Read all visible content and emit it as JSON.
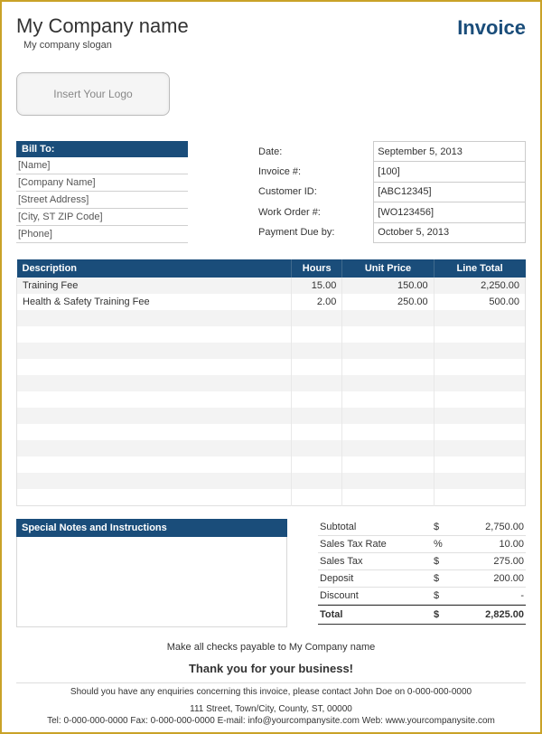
{
  "header": {
    "company_name": "My Company name",
    "company_slogan": "My company slogan",
    "invoice_label": "Invoice",
    "logo_placeholder": "Insert Your Logo"
  },
  "bill_to": {
    "header": "Bill To:",
    "lines": [
      "[Name]",
      "[Company Name]",
      "[Street Address]",
      "[City, ST  ZIP Code]",
      "[Phone]"
    ]
  },
  "meta": [
    {
      "label": "Date:",
      "value": "September 5, 2013"
    },
    {
      "label": "Invoice #:",
      "value": "[100]"
    },
    {
      "label": "Customer ID:",
      "value": "[ABC12345]"
    },
    {
      "label": "Work Order #:",
      "value": "[WO123456]"
    },
    {
      "label": "Payment Due by:",
      "value": "October 5, 2013"
    }
  ],
  "items": {
    "headers": {
      "description": "Description",
      "hours": "Hours",
      "unit_price": "Unit Price",
      "line_total": "Line Total"
    },
    "rows": [
      {
        "description": "Training Fee",
        "hours": "15.00",
        "unit_price": "150.00",
        "line_total": "2,250.00"
      },
      {
        "description": "Health & Safety Training Fee",
        "hours": "2.00",
        "unit_price": "250.00",
        "line_total": "500.00"
      },
      {
        "description": "",
        "hours": "",
        "unit_price": "",
        "line_total": ""
      },
      {
        "description": "",
        "hours": "",
        "unit_price": "",
        "line_total": ""
      },
      {
        "description": "",
        "hours": "",
        "unit_price": "",
        "line_total": ""
      },
      {
        "description": "",
        "hours": "",
        "unit_price": "",
        "line_total": ""
      },
      {
        "description": "",
        "hours": "",
        "unit_price": "",
        "line_total": ""
      },
      {
        "description": "",
        "hours": "",
        "unit_price": "",
        "line_total": ""
      },
      {
        "description": "",
        "hours": "",
        "unit_price": "",
        "line_total": ""
      },
      {
        "description": "",
        "hours": "",
        "unit_price": "",
        "line_total": ""
      },
      {
        "description": "",
        "hours": "",
        "unit_price": "",
        "line_total": ""
      },
      {
        "description": "",
        "hours": "",
        "unit_price": "",
        "line_total": ""
      },
      {
        "description": "",
        "hours": "",
        "unit_price": "",
        "line_total": ""
      },
      {
        "description": "",
        "hours": "",
        "unit_price": "",
        "line_total": ""
      }
    ]
  },
  "notes": {
    "header": "Special Notes and Instructions"
  },
  "totals": [
    {
      "label": "Subtotal",
      "symbol": "$",
      "value": "2,750.00"
    },
    {
      "label": "Sales Tax Rate",
      "symbol": "%",
      "value": "10.00"
    },
    {
      "label": "Sales Tax",
      "symbol": "$",
      "value": "275.00"
    },
    {
      "label": "Deposit",
      "symbol": "$",
      "value": "200.00"
    },
    {
      "label": "Discount",
      "symbol": "$",
      "value": "-"
    }
  ],
  "grand_total": {
    "label": "Total",
    "symbol": "$",
    "value": "2,825.00"
  },
  "footer": {
    "payable": "Make all checks payable to My Company name",
    "thankyou": "Thank you for your business!",
    "enquiry": "Should you have any enquiries concerning this invoice, please contact John Doe on 0-000-000-0000",
    "contact_line1": "111 Street, Town/City, County, ST, 00000",
    "contact_line2": "Tel: 0-000-000-0000 Fax: 0-000-000-0000 E-mail: info@yourcompanysite.com Web: www.yourcompanysite.com"
  }
}
